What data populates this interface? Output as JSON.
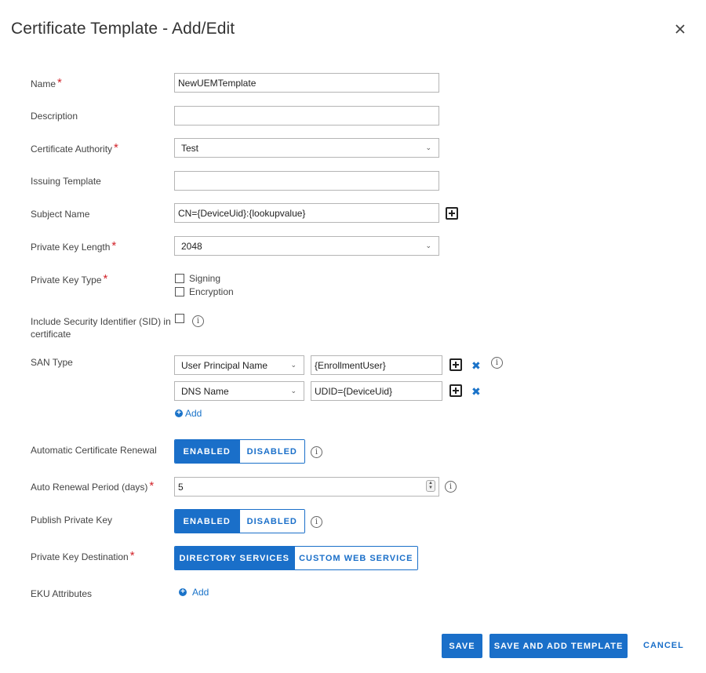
{
  "dialog": {
    "title": "Certificate Template - Add/Edit"
  },
  "labels": {
    "name": "Name",
    "description": "Description",
    "ca": "Certificate Authority",
    "issuing_template": "Issuing Template",
    "subject_name": "Subject Name",
    "key_length": "Private Key Length",
    "key_type": "Private Key Type",
    "sid_line1": "Include Security Identifier (SID) in",
    "sid_line2": "certificate",
    "san_type": "SAN Type",
    "auto_renewal": "Automatic Certificate Renewal",
    "renewal_period": "Auto Renewal Period (days)",
    "publish_key": "Publish Private Key",
    "key_destination": "Private Key Destination",
    "eku": "EKU Attributes"
  },
  "required_marker": "*",
  "fields": {
    "name": "NewUEMTemplate",
    "description": "",
    "ca": "Test",
    "issuing_template": "",
    "subject_name": "CN={DeviceUid}:{lookupvalue}",
    "key_length": "2048",
    "renewal_period": "5"
  },
  "key_type": {
    "signing": "Signing",
    "encryption": "Encryption"
  },
  "san": {
    "rows": [
      {
        "type": "User Principal Name",
        "value": "{EnrollmentUser}"
      },
      {
        "type": "DNS Name",
        "value": "UDID={DeviceUid}"
      }
    ],
    "add_label": "Add"
  },
  "toggles": {
    "enabled": "ENABLED",
    "disabled": "DISABLED",
    "directory_services": "DIRECTORY SERVICES",
    "custom_web_service": "CUSTOM WEB SERVICE"
  },
  "eku": {
    "add_label": "Add"
  },
  "footer": {
    "save": "SAVE",
    "save_add": "SAVE AND ADD TEMPLATE",
    "cancel": "CANCEL"
  },
  "icons": {
    "info": "i",
    "chevron": "⌄",
    "close": "close-icon"
  },
  "colors": {
    "accent": "#1a6fc9",
    "required": "#d2232a"
  }
}
